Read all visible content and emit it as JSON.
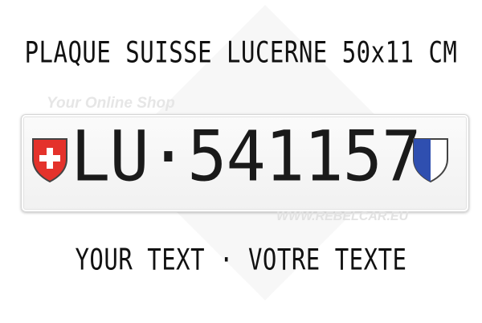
{
  "header": {
    "title": "PLAQUE SUISSE LUCERNE 50x11 CM"
  },
  "watermark": {
    "top_text": "Your Online Shop",
    "bottom_text": "WWW.REBELCAR.EU"
  },
  "plate": {
    "number": "LU·541157",
    "left_emblem": "swiss-cross-shield-icon",
    "right_emblem": "lucerne-canton-shield-icon"
  },
  "footer": {
    "subtitle": "YOUR TEXT · VOTRE TEXTE"
  },
  "colors": {
    "swiss_red": "#e4322b",
    "lucerne_blue": "#2f4fb0",
    "text": "#111111",
    "plate_bg": "#f6f6f6"
  }
}
